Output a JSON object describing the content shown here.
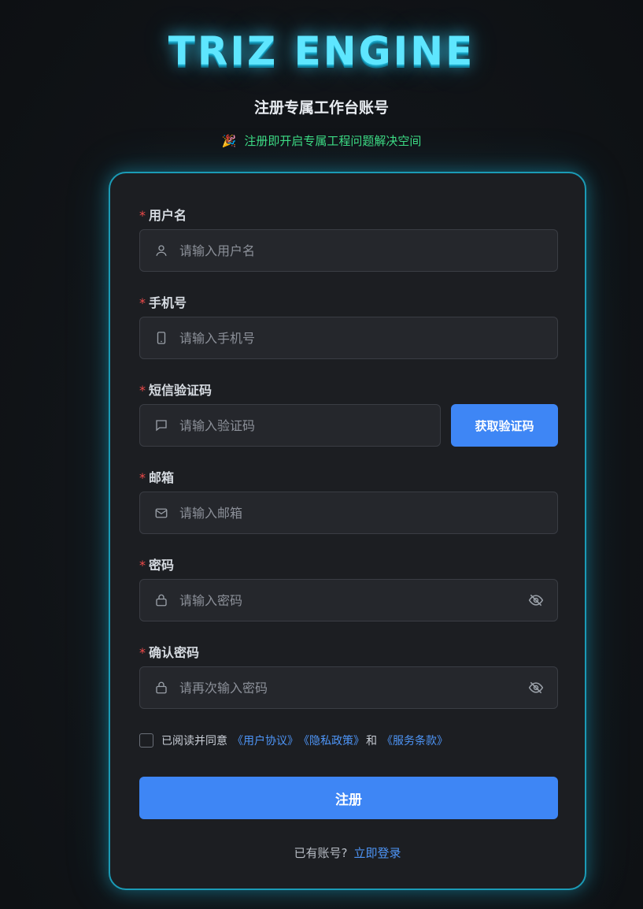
{
  "logo": "TRIZ ENGINE",
  "subtitle": "注册专属工作台账号",
  "tagline": {
    "icon": "party-popper-icon",
    "text": "注册即开启专属工程问题解决空间"
  },
  "fields": {
    "username": {
      "label": "用户名",
      "placeholder": "请输入用户名",
      "icon": "user-icon"
    },
    "phone": {
      "label": "手机号",
      "placeholder": "请输入手机号",
      "icon": "phone-icon"
    },
    "sms_code": {
      "label": "短信验证码",
      "placeholder": "请输入验证码",
      "icon": "message-icon",
      "button": "获取验证码"
    },
    "email": {
      "label": "邮箱",
      "placeholder": "请输入邮箱",
      "icon": "mail-icon"
    },
    "password": {
      "label": "密码",
      "placeholder": "请输入密码",
      "icon": "lock-icon"
    },
    "confirm_password": {
      "label": "确认密码",
      "placeholder": "请再次输入密码",
      "icon": "lock-icon"
    }
  },
  "required_mark": "*",
  "agreement": {
    "prefix": "已阅读并同意",
    "user_agreement": "《用户协议》",
    "privacy_policy": "《隐私政策》",
    "and": "和",
    "terms": "《服务条款》",
    "checked": false
  },
  "submit_label": "注册",
  "login": {
    "prompt": "已有账号?",
    "link": "立即登录"
  },
  "colors": {
    "accent": "#3e86f5",
    "logo": "#5ee6ff",
    "card_border": "#1b9bb6",
    "tagline": "#3ddc84",
    "required": "#f04a4a",
    "link": "#4e95f7"
  }
}
